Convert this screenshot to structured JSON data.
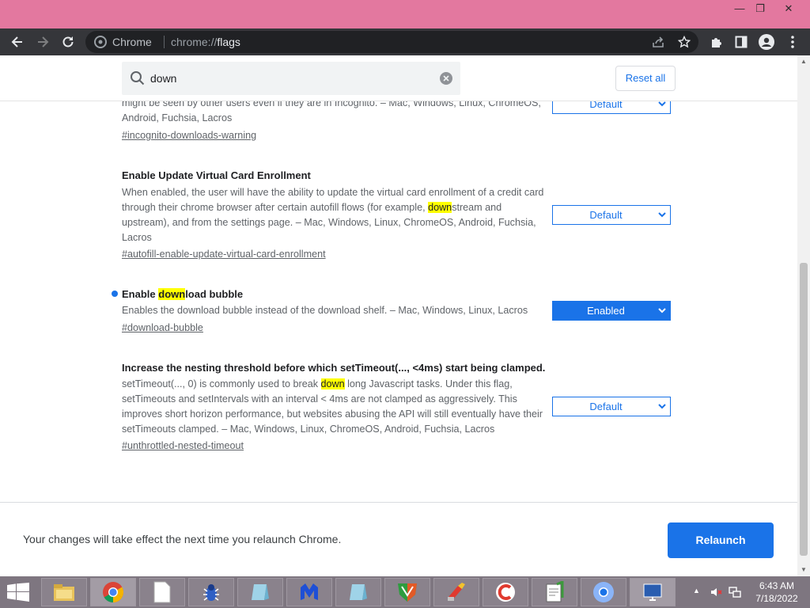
{
  "browser": {
    "omnibox_label": "Chrome",
    "url_scheme": "chrome://",
    "url_host": "flags"
  },
  "search": {
    "value": "down",
    "reset_label": "Reset all"
  },
  "flags": [
    {
      "desc_html": "might be seen by other users even if they are in Incognito. – Mac, Windows, Linux, ChromeOS, Android, Fuchsia, Lacros",
      "link": "#incognito-downloads-warning",
      "select": "Default"
    },
    {
      "title_html": "Enable Update Virtual Card Enrollment",
      "desc_html": "When enabled, the user will have the ability to update the virtual card enrollment of a credit card through their chrome browser after certain autofill flows (for example, <span class=\"mark\">down</span>stream and upstream), and from the settings page. – Mac, Windows, Linux, ChromeOS, Android, Fuchsia, Lacros",
      "link": "#autofill-enable-update-virtual-card-enrollment",
      "select": "Default"
    },
    {
      "title_html": "Enable <span class=\"mark\">down</span>load bubble",
      "desc_html": "Enables the download bubble instead of the download shelf. – Mac, Windows, Linux, Lacros",
      "link": "#download-bubble",
      "select": "Enabled"
    },
    {
      "title_html": "Increase the nesting threshold before which setTimeout(..., &lt;4ms) start being clamped.",
      "desc_html": "setTimeout(..., 0) is commonly used to break <span class=\"mark\">down</span> long Javascript tasks. Under this flag, setTimeouts and setIntervals with an interval &lt; 4ms are not clamped as aggressively. This improves short horizon performance, but websites abusing the API will still eventually have their setTimeouts clamped. – Mac, Windows, Linux, ChromeOS, Android, Fuchsia, Lacros",
      "link": "#unthrottled-nested-timeout",
      "select": "Default"
    }
  ],
  "relaunch": {
    "message": "Your changes will take effect the next time you relaunch Chrome.",
    "button_label": "Relaunch"
  },
  "taskbar": {
    "time": "6:43 AM",
    "date": "7/18/2022"
  },
  "colors": {
    "titlebar": "#e3789f",
    "accent": "#1a73e8",
    "highlight": "#ffff00"
  }
}
